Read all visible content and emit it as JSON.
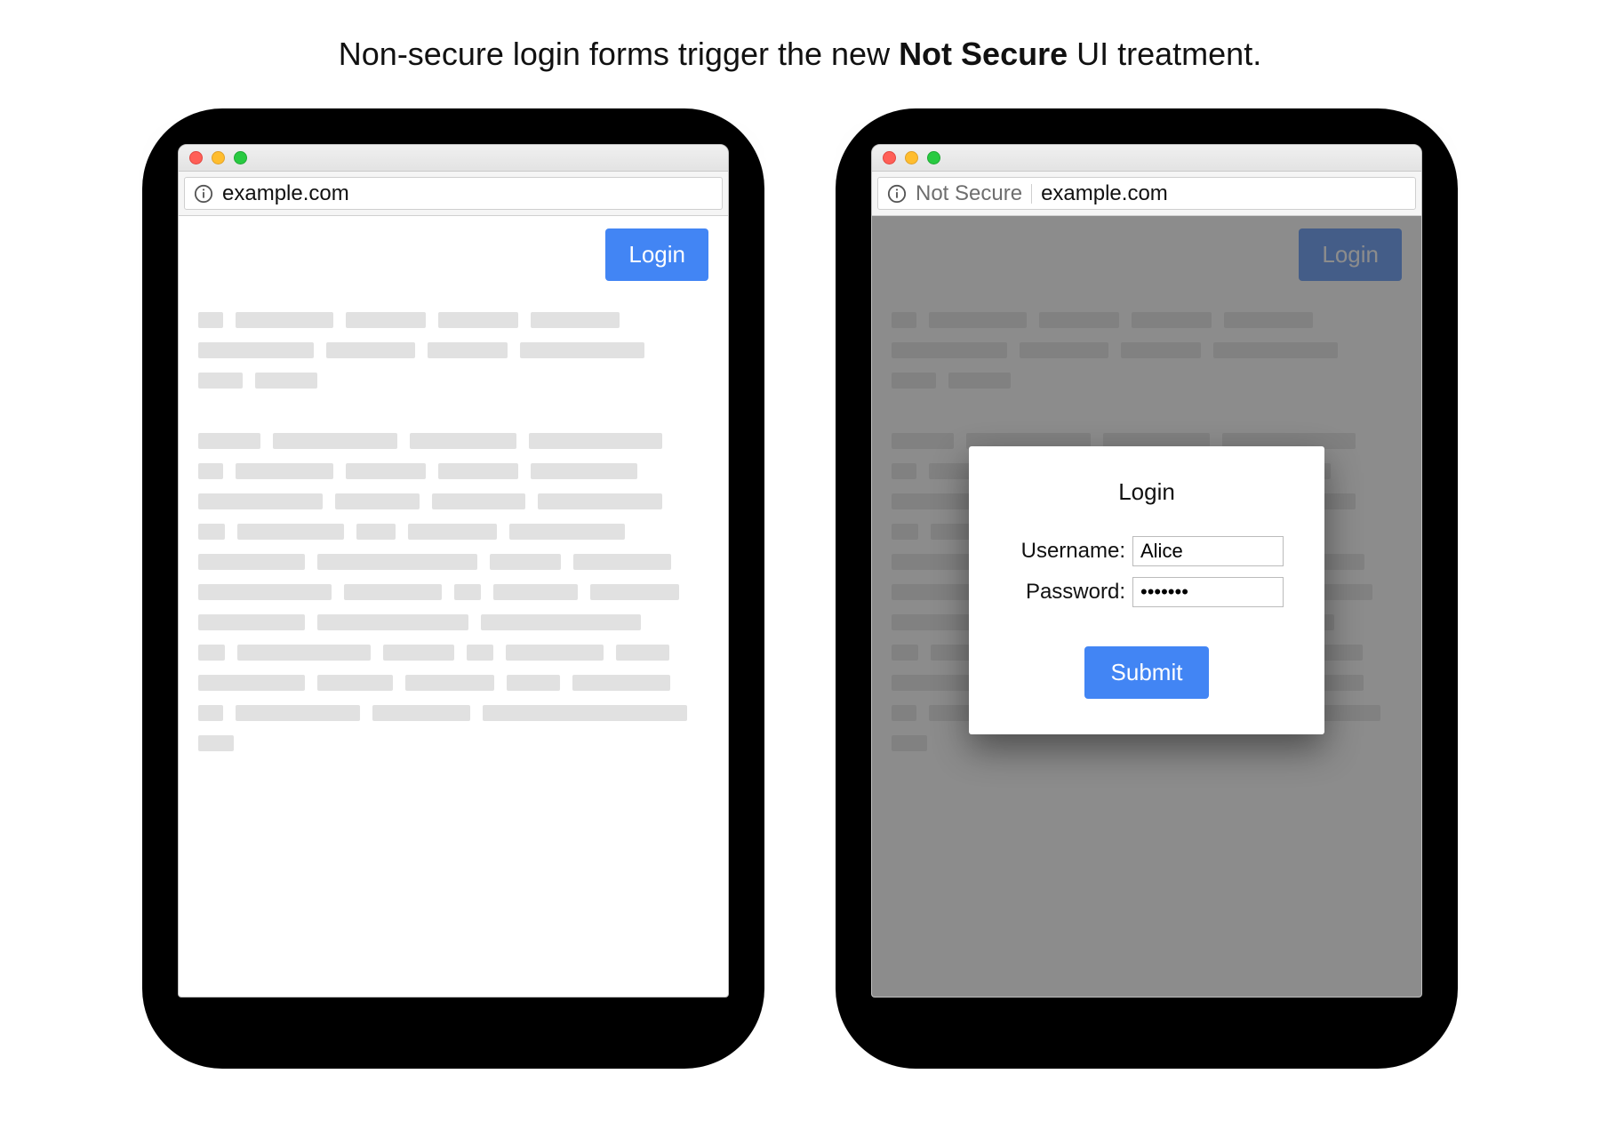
{
  "caption": {
    "prefix": "Non-secure login forms trigger the new ",
    "bold": "Not Secure",
    "suffix": " UI treatment."
  },
  "left_window": {
    "address": "example.com",
    "login_button": "Login"
  },
  "right_window": {
    "not_secure_label": "Not Secure",
    "address": "example.com",
    "login_button": "Login",
    "modal": {
      "title": "Login",
      "username_label": "Username:",
      "username_value": "Alice",
      "password_label": "Password:",
      "password_value": "•••••••",
      "submit_label": "Submit"
    }
  },
  "colors": {
    "primary_button": "#4285f4",
    "traffic_red": "#ff5f57",
    "traffic_yellow": "#ffbd2e",
    "traffic_green": "#28ca41"
  }
}
